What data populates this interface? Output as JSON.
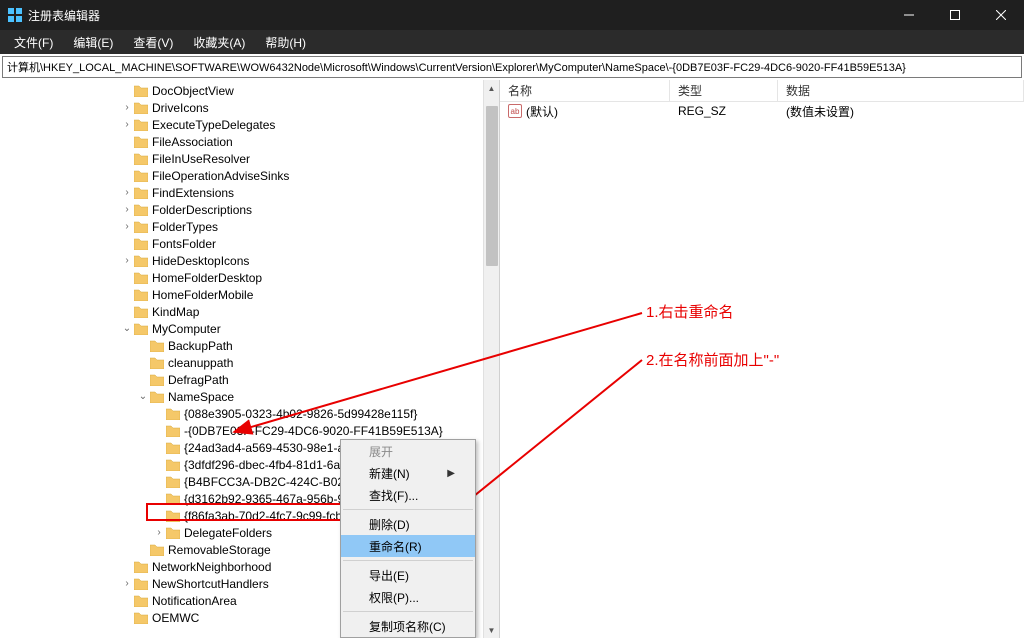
{
  "window": {
    "title": "注册表编辑器"
  },
  "menu": {
    "file": "文件(F)",
    "edit": "编辑(E)",
    "view": "查看(V)",
    "favorites": "收藏夹(A)",
    "help": "帮助(H)"
  },
  "address": "计算机\\HKEY_LOCAL_MACHINE\\SOFTWARE\\WOW6432Node\\Microsoft\\Windows\\CurrentVersion\\Explorer\\MyComputer\\NameSpace\\-{0DB7E03F-FC29-4DC6-9020-FF41B59E513A}",
  "tree": {
    "items": [
      "DocObjectView",
      "DriveIcons",
      "ExecuteTypeDelegates",
      "FileAssociation",
      "FileInUseResolver",
      "FileOperationAdviseSinks",
      "FindExtensions",
      "FolderDescriptions",
      "FolderTypes",
      "FontsFolder",
      "HideDesktopIcons",
      "HomeFolderDesktop",
      "HomeFolderMobile",
      "KindMap",
      "MyComputer",
      "NetworkNeighborhood",
      "NewShortcutHandlers",
      "NotificationArea",
      "OEMWC"
    ],
    "mycomputer_children": [
      "BackupPath",
      "cleanuppath",
      "DefragPath",
      "NameSpace",
      "RemovableStorage"
    ],
    "namespace_children": [
      "{088e3905-0323-4b02-9826-5d99428e115f}",
      "-{0DB7E03F-FC29-4DC6-9020-FF41B59E513A}",
      "{24ad3ad4-a569-4530-98e1-a",
      "{3dfdf296-dbec-4fb4-81d1-6a",
      "{B4BFCC3A-DB2C-424C-B029-",
      "{d3162b92-9365-467a-956b-9",
      "{f86fa3ab-70d2-4fc7-9c99-fcb",
      "DelegateFolders"
    ]
  },
  "list": {
    "header": {
      "name": "名称",
      "type": "类型",
      "data": "数据"
    },
    "rows": [
      {
        "name": "(默认)",
        "type": "REG_SZ",
        "data": "(数值未设置)"
      }
    ]
  },
  "context_menu": {
    "expand": "展开",
    "new": "新建(N)",
    "find": "查找(F)...",
    "delete": "删除(D)",
    "rename": "重命名(R)",
    "export": "导出(E)",
    "permissions": "权限(P)...",
    "copy_key_name": "复制项名称(C)"
  },
  "annotations": {
    "step1": "1.右击重命名",
    "step2": "2.在名称前面加上\"-\""
  }
}
